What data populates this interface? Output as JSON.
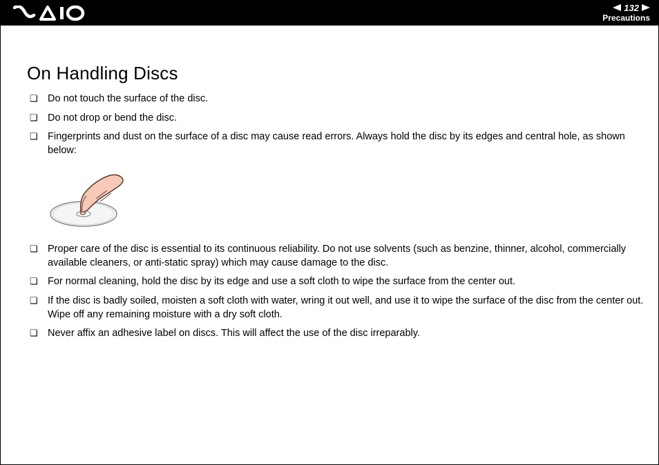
{
  "header": {
    "page_number": "132",
    "section": "Precautions",
    "logo_alt": "VAIO"
  },
  "title": "On Handling Discs",
  "bullets_top": [
    "Do not touch the surface of the disc.",
    "Do not drop or bend the disc.",
    "Fingerprints and dust on the surface of a disc may cause read errors. Always hold the disc by its edges and central hole, as shown below:"
  ],
  "bullets_bottom": [
    "Proper care of the disc is essential to its continuous reliability. Do not use solvents (such as benzine, thinner, alcohol, commercially available cleaners, or anti-static spray) which may cause damage to the disc.",
    "For normal cleaning, hold the disc by its edge and use a soft cloth to wipe the surface from the center out.",
    "If the disc is badly soiled, moisten a soft cloth with water, wring it out well, and use it to wipe the surface of the disc from the center out. Wipe off any remaining moisture with a dry soft cloth.",
    "Never affix an adhesive label on discs. This will affect the use of the disc irreparably."
  ],
  "illustration_alt": "Hand holding a disc by its edges and central hole"
}
